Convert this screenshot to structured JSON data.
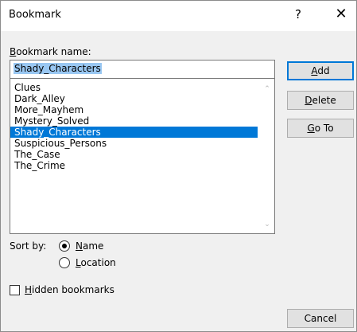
{
  "window": {
    "title": "Bookmark",
    "help_glyph": "?",
    "close_glyph": "✕"
  },
  "bookmark_name_label": "Bookmark name:",
  "bookmark_name_value": "Shady_Characters",
  "bookmarks": [
    {
      "label": "Clues",
      "selected": false
    },
    {
      "label": "Dark_Alley",
      "selected": false
    },
    {
      "label": "More_Mayhem",
      "selected": false
    },
    {
      "label": "Mystery_Solved",
      "selected": false
    },
    {
      "label": "Shady_Characters",
      "selected": true
    },
    {
      "label": "Suspicious_Persons",
      "selected": false
    },
    {
      "label": "The_Case",
      "selected": false
    },
    {
      "label": "The_Crime",
      "selected": false
    }
  ],
  "buttons": {
    "add": "Add",
    "delete": "Delete",
    "goto": "Go To",
    "cancel": "Cancel"
  },
  "sort": {
    "label": "Sort by:",
    "options": [
      "Name",
      "Location"
    ],
    "selected": "Name"
  },
  "hidden_bookmarks": {
    "label": "Hidden bookmarks",
    "checked": false
  },
  "colors": {
    "selection": "#0078d7",
    "input_highlight": "#99c7f2"
  }
}
